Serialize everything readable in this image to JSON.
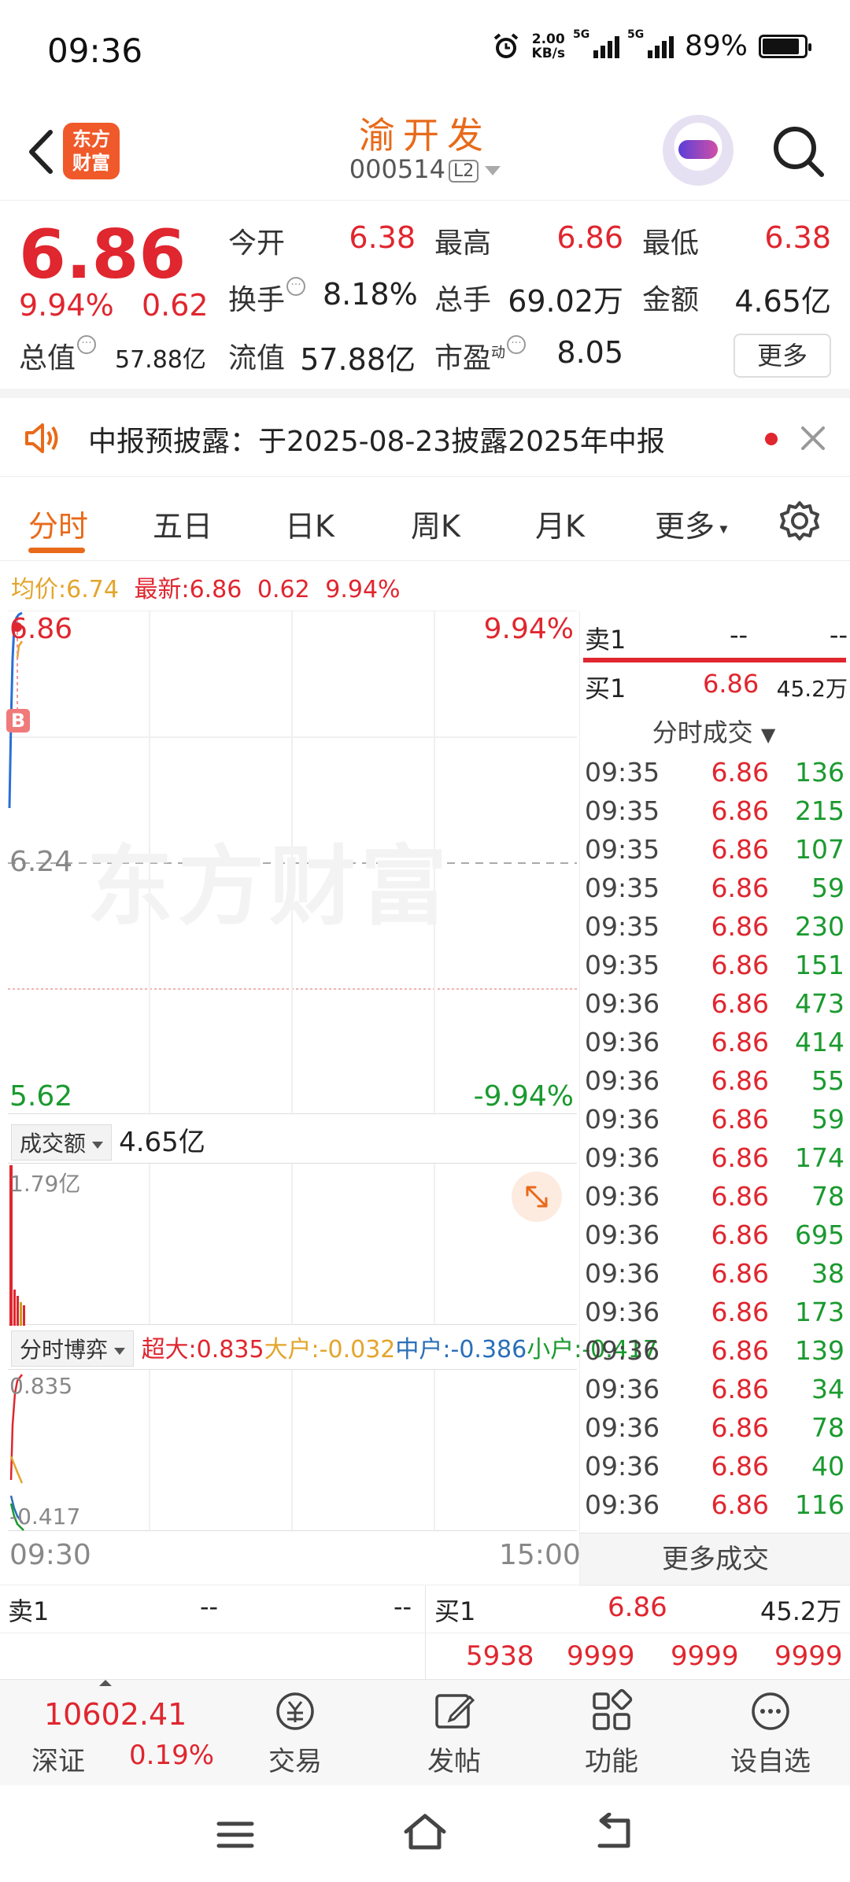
{
  "status": {
    "time": "09:36",
    "net_speed_top": "2.00",
    "net_speed_unit": "KB/s",
    "sig1": "5G",
    "sig2": "5G",
    "battery": "89%",
    "battery_level": 0.89
  },
  "header": {
    "logo_line1": "东方",
    "logo_line2": "财富",
    "title": "渝开发",
    "code": "000514",
    "l2": "L2"
  },
  "quote": {
    "price": "6.86",
    "pct": "9.94%",
    "change": "0.62",
    "open_label": "今开",
    "open": "6.38",
    "high_label": "最高",
    "high": "6.86",
    "low_label": "最低",
    "low": "6.38",
    "turnover_label": "换手",
    "turnover": "8.18%",
    "volume_label": "总手",
    "volume": "69.02万",
    "amount_label": "金额",
    "amount": "4.65亿",
    "mktcap_label": "总值",
    "mktcap": "57.88亿",
    "float_label": "流值",
    "float": "57.88亿",
    "pe_label": "市盈",
    "pe_sup": "动",
    "pe": "8.05",
    "more": "更多"
  },
  "notice": {
    "text": "中报预披露：于2025-08-23披露2025年中报"
  },
  "tabs": [
    "分时",
    "五日",
    "日K",
    "周K",
    "月K",
    "更多"
  ],
  "chart": {
    "avg_label": "均价:",
    "avg": "6.74",
    "latest_label": "最新:",
    "latest": "6.86",
    "latest_chg": "0.62",
    "latest_pct": "9.94%",
    "top_price": "6.86",
    "top_pct": "9.94%",
    "mid_price": "6.24",
    "bottom_price": "5.62",
    "bottom_pct": "-9.94%",
    "b_marker": "B",
    "watermark": "东方财富",
    "vol_selector": "成交额",
    "vol_total": "4.65亿",
    "vol_max": "1.79亿",
    "flow_selector": "分时博弈",
    "flow_super_label": "超大:",
    "flow_super": "0.835",
    "flow_large_label": "大户:",
    "flow_large": "-0.032",
    "flow_mid_label": "中户:",
    "flow_mid": "-0.386",
    "flow_small_label": "小户:",
    "flow_small": "-0.417",
    "flow_top": "0.835",
    "flow_bottom": "-0.417",
    "time_start": "09:30",
    "time_end": "15:00"
  },
  "side": {
    "sell1_label": "卖1",
    "sell1_price": "--",
    "sell1_vol": "--",
    "buy1_label": "买1",
    "buy1_price": "6.86",
    "buy1_vol": "45.2万",
    "ticks_title": "分时成交",
    "ticks": [
      {
        "time": "09:35",
        "price": "6.86",
        "vol": "136"
      },
      {
        "time": "09:35",
        "price": "6.86",
        "vol": "215"
      },
      {
        "time": "09:35",
        "price": "6.86",
        "vol": "107"
      },
      {
        "time": "09:35",
        "price": "6.86",
        "vol": "59"
      },
      {
        "time": "09:35",
        "price": "6.86",
        "vol": "230"
      },
      {
        "time": "09:35",
        "price": "6.86",
        "vol": "151"
      },
      {
        "time": "09:36",
        "price": "6.86",
        "vol": "473"
      },
      {
        "time": "09:36",
        "price": "6.86",
        "vol": "414"
      },
      {
        "time": "09:36",
        "price": "6.86",
        "vol": "55"
      },
      {
        "time": "09:36",
        "price": "6.86",
        "vol": "59"
      },
      {
        "time": "09:36",
        "price": "6.86",
        "vol": "174"
      },
      {
        "time": "09:36",
        "price": "6.86",
        "vol": "78"
      },
      {
        "time": "09:36",
        "price": "6.86",
        "vol": "695"
      },
      {
        "time": "09:36",
        "price": "6.86",
        "vol": "38"
      },
      {
        "time": "09:36",
        "price": "6.86",
        "vol": "173"
      },
      {
        "time": "09:36",
        "price": "6.86",
        "vol": "139"
      },
      {
        "time": "09:36",
        "price": "6.86",
        "vol": "34"
      },
      {
        "time": "09:36",
        "price": "6.86",
        "vol": "78"
      },
      {
        "time": "09:36",
        "price": "6.86",
        "vol": "40"
      },
      {
        "time": "09:36",
        "price": "6.86",
        "vol": "116"
      }
    ],
    "more_ticks": "更多成交"
  },
  "book": {
    "sell_label": "卖1",
    "sell_price": "--",
    "sell_vol": "--",
    "buy_label": "买1",
    "buy_price": "6.86",
    "buy_vol": "45.2万",
    "queue": [
      "5938",
      "9999",
      "9999",
      "9999"
    ]
  },
  "bottombar": {
    "index_value": "10602.41",
    "index_name": "深证",
    "index_pct": "0.19%",
    "trade": "交易",
    "post": "发帖",
    "func": "功能",
    "watch": "设自选"
  }
}
